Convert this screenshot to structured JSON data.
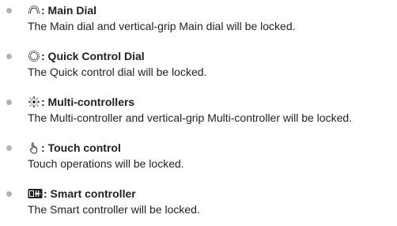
{
  "items": [
    {
      "icon": "main-dial-icon",
      "title": ": Main Dial",
      "description": "The Main dial and vertical-grip Main dial will be locked."
    },
    {
      "icon": "quick-control-dial-icon",
      "title": ": Quick Control Dial",
      "description": "The Quick control dial will be locked."
    },
    {
      "icon": "multi-controller-icon",
      "title": ": Multi-controllers",
      "description": "The Multi-controller and vertical-grip Multi-controller will be locked."
    },
    {
      "icon": "touch-control-icon",
      "title": ": Touch control",
      "description": "Touch operations will be locked."
    },
    {
      "icon": "smart-controller-icon",
      "title": ": Smart controller",
      "description": "The Smart controller will be locked."
    }
  ],
  "colors": {
    "text": "#231f20",
    "bullet": "#b3b3b3"
  }
}
